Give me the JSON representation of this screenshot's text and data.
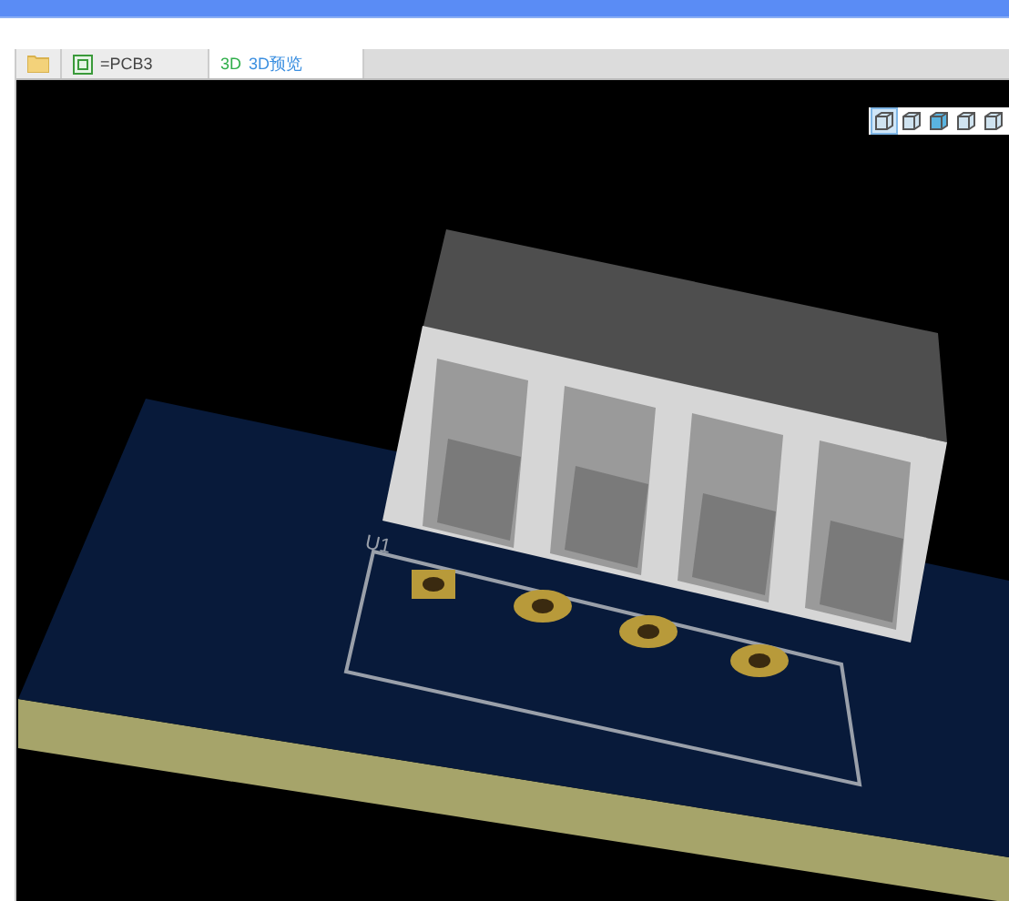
{
  "tabs": [
    {
      "kind": "folder",
      "selected": false
    },
    {
      "kind": "pcb",
      "label": "=PCB3",
      "selected": false
    },
    {
      "kind": "preview",
      "prefix": "3D",
      "label": "3D预览",
      "selected": true
    }
  ],
  "view_tools": [
    {
      "selected": true
    },
    {
      "selected": false
    },
    {
      "selected": false
    },
    {
      "selected": false
    },
    {
      "selected": false
    }
  ],
  "board": {
    "designator": "U1"
  }
}
